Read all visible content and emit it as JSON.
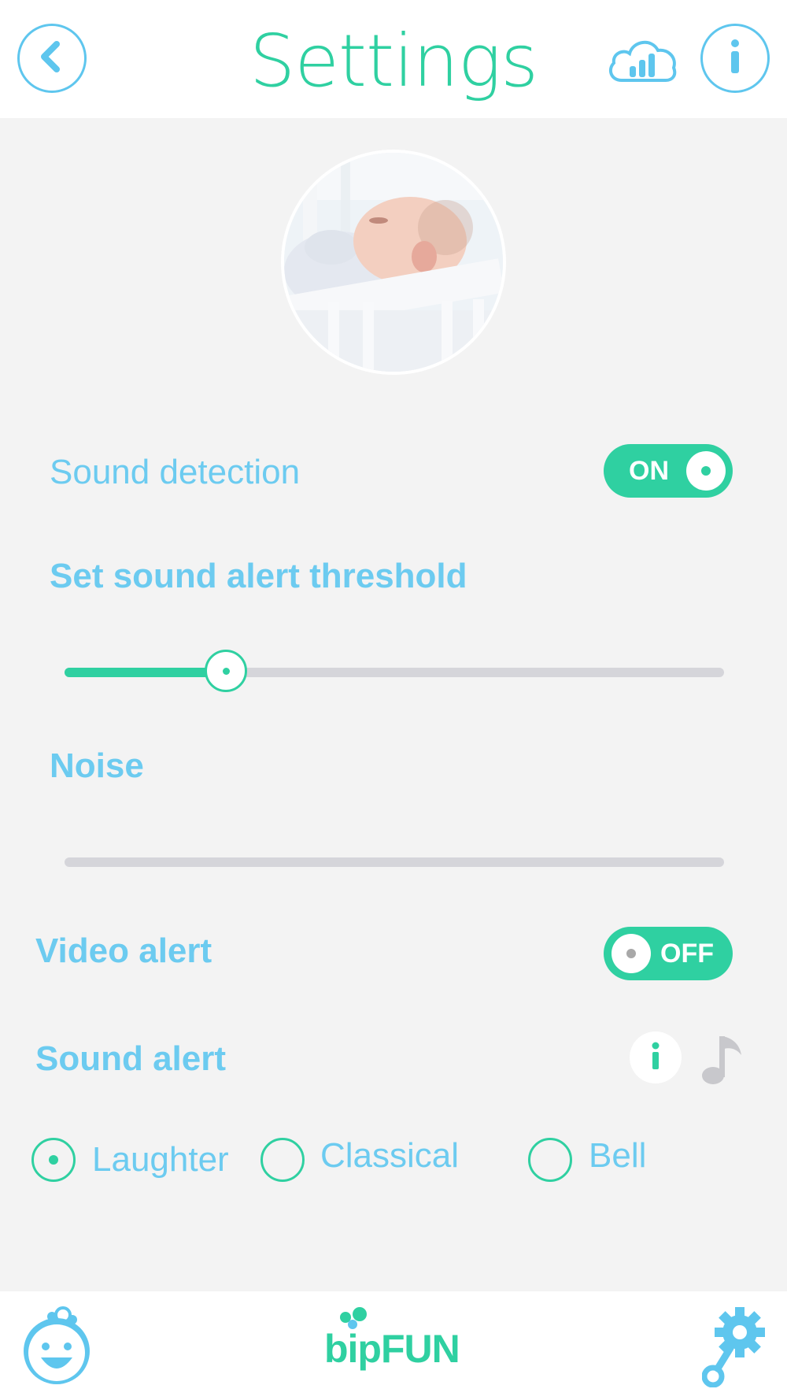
{
  "header": {
    "title": "Settings",
    "back_icon": "chevron-left-icon",
    "cloud_icon": "cloud-chart-icon",
    "info_icon": "info-icon"
  },
  "colors": {
    "accent": "#2fd0a1",
    "label": "#6ccbf0",
    "track": "#d5d5da",
    "background": "#f3f3f3"
  },
  "sound_detection": {
    "label": "Sound detection",
    "toggle_text": "ON",
    "state": true
  },
  "threshold": {
    "label": "Set sound alert threshold",
    "value_fraction": 0.24
  },
  "noise": {
    "label": "Noise",
    "value_fraction": 0.0
  },
  "video_alert": {
    "label": "Video alert",
    "toggle_text": "OFF",
    "state": false
  },
  "sound_alert": {
    "label": "Sound alert",
    "info_icon": "info-icon",
    "music_icon": "music-note-icon",
    "options": [
      {
        "label": "Laughter",
        "selected": true
      },
      {
        "label": "Classical",
        "selected": false
      },
      {
        "label": "Bell",
        "selected": false
      }
    ]
  },
  "footer": {
    "baby_icon": "baby-face-icon",
    "logo_text": "bipFUN",
    "settings_icon": "gear-rattle-icon"
  }
}
